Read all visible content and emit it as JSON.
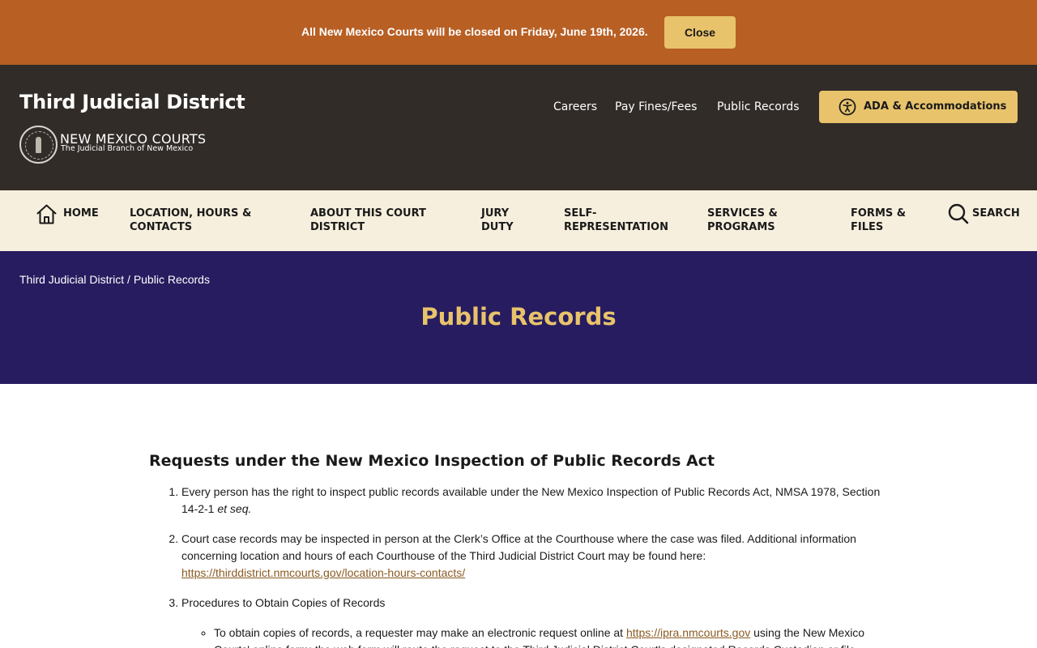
{
  "alert": {
    "message": "All New Mexico Courts will be closed on Friday, June 19th, 2026.",
    "close_label": "Close"
  },
  "header": {
    "site_title": "Third Judicial District",
    "logo_title": "NEW MEXICO COURTS",
    "logo_subtitle": "The Judicial Branch of New Mexico",
    "utility_links": {
      "careers": "Careers",
      "pay": "Pay Fines/Fees",
      "records": "Public Records"
    },
    "ada_label": "ADA & Accommodations"
  },
  "nav": {
    "home": "HOME",
    "location": "LOCATION, HOURS & CONTACTS",
    "about": "ABOUT THIS COURT DISTRICT",
    "jury": "JURY DUTY",
    "self": "SELF-REPRESENTATION",
    "services": "SERVICES & PROGRAMS",
    "forms": "FORMS & FILES",
    "search": "SEARCH"
  },
  "hero": {
    "breadcrumb_home": "Third Judicial District",
    "breadcrumb_sep": " / ",
    "breadcrumb_current": "Public Records",
    "title": "Public Records"
  },
  "content": {
    "heading": "Requests under the New Mexico Inspection of Public Records Act",
    "item1_text": "Every person has the right to inspect public records available under the New Mexico Inspection of Public Records Act, NMSA 1978, Section 14-2-1 ",
    "item1_italic": "et seq.",
    "item2_text": "Court case records may be inspected in person at the Clerk’s Office at the Courthouse where the case was filed.  Additional information concerning location and hours of each Courthouse of the Third Judicial District Court may be found here:  ",
    "item2_link": "https://thirddistrict.nmcourts.gov/location-hours-contacts/",
    "item3_text": "Procedures to Obtain Copies of Records",
    "sub1_text": "To obtain copies of records, a requester may make an electronic request online at ",
    "sub1_link": "https://ipra.nmcourts.gov",
    "sub1_after": " using the New Mexico Courts' online form; the web form will route the request to the Third Judicial District Court's designated Records Custodian or file"
  },
  "colors": {
    "alert_bg": "#b85f24",
    "header_bg": "#312c28",
    "nav_bg": "#f7efdd",
    "hero_bg": "#271c5f",
    "accent_gold": "#e8c36b",
    "link": "#8a5a22"
  }
}
